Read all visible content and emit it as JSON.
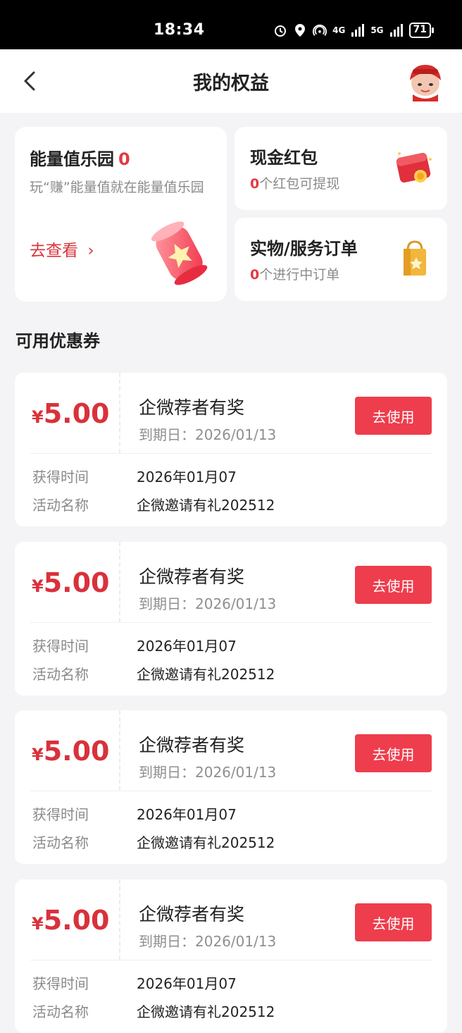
{
  "status_bar": {
    "time": "18:34",
    "signal_1": "4G",
    "signal_2": "5G",
    "battery": "71"
  },
  "header": {
    "title": "我的权益"
  },
  "energy_card": {
    "title": "能量值乐园",
    "count": "0",
    "description": "玩“赚”能量值就在能量值乐园",
    "link_label": "去查看",
    "link_arrow": "›"
  },
  "cash_card": {
    "title": "现金红包",
    "count": "0",
    "suffix": "个红包可提现"
  },
  "order_card": {
    "title": "实物/服务订单",
    "count": "0",
    "suffix": "个进行中订单"
  },
  "section": {
    "title": "可用优惠券"
  },
  "coupon_labels": {
    "currency": "¥",
    "expiry_prefix": "到期日：",
    "obtained_label": "获得时间",
    "activity_label": "活动名称",
    "use_button": "去使用"
  },
  "coupons": [
    {
      "amount": "5.00",
      "name": "企微荐者有奖",
      "expiry": "2026/01/13",
      "obtained": "2026年01月07",
      "activity": "企微邀请有礼202512"
    },
    {
      "amount": "5.00",
      "name": "企微荐者有奖",
      "expiry": "2026/01/13",
      "obtained": "2026年01月07",
      "activity": "企微邀请有礼202512"
    },
    {
      "amount": "5.00",
      "name": "企微荐者有奖",
      "expiry": "2026/01/13",
      "obtained": "2026年01月07",
      "activity": "企微邀请有礼202512"
    },
    {
      "amount": "5.00",
      "name": "企微荐者有奖",
      "expiry": "2026/01/13",
      "obtained": "2026年01月07",
      "activity": "企微邀请有礼202512"
    }
  ],
  "colors": {
    "accent": "#ee3d4c",
    "price": "#d9313b"
  }
}
